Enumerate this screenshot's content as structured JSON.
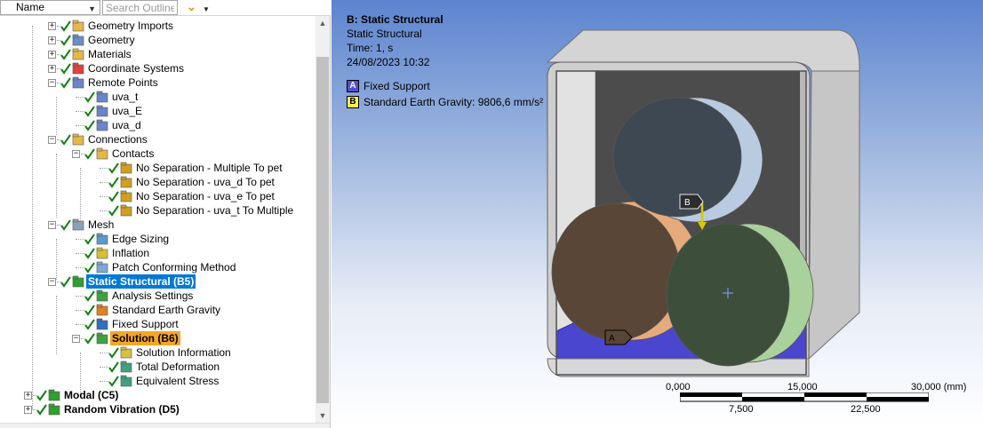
{
  "outline_header": {
    "name_select": "Name",
    "search_placeholder": "Search Outline"
  },
  "tree": [
    {
      "label": "Geometry Imports",
      "icon": "geometry-imports-icon"
    },
    {
      "label": "Geometry",
      "icon": "geometry-icon"
    },
    {
      "label": "Materials",
      "icon": "materials-icon"
    },
    {
      "label": "Coordinate Systems",
      "icon": "coordinate-systems-icon"
    },
    {
      "label": "Remote Points",
      "icon": "remote-points-icon"
    },
    {
      "label": "uva_t",
      "icon": "remote-point-icon"
    },
    {
      "label": "uva_E",
      "icon": "remote-point-icon"
    },
    {
      "label": "uva_d",
      "icon": "remote-point-icon"
    },
    {
      "label": "Connections",
      "icon": "connections-icon"
    },
    {
      "label": "Contacts",
      "icon": "contacts-folder-icon"
    },
    {
      "label": "No Separation - Multiple To pet",
      "icon": "contact-region-icon"
    },
    {
      "label": "No Separation - uva_d To pet",
      "icon": "contact-region-icon"
    },
    {
      "label": "No Separation - uva_e To pet",
      "icon": "contact-region-icon"
    },
    {
      "label": "No Separation - uva_t To Multiple",
      "icon": "contact-region-icon"
    },
    {
      "label": "Mesh",
      "icon": "mesh-icon"
    },
    {
      "label": "Edge Sizing",
      "icon": "edge-sizing-icon"
    },
    {
      "label": "Inflation",
      "icon": "inflation-icon"
    },
    {
      "label": "Patch Conforming Method",
      "icon": "patch-conforming-icon"
    },
    {
      "label": "Static Structural (B5)",
      "icon": "static-structural-icon"
    },
    {
      "label": "Analysis Settings",
      "icon": "analysis-settings-icon"
    },
    {
      "label": "Standard Earth Gravity",
      "icon": "gravity-icon"
    },
    {
      "label": "Fixed Support",
      "icon": "fixed-support-icon"
    },
    {
      "label": "Solution (B6)",
      "icon": "solution-icon"
    },
    {
      "label": "Solution Information",
      "icon": "solution-information-icon"
    },
    {
      "label": "Total Deformation",
      "icon": "total-deformation-icon"
    },
    {
      "label": "Equivalent Stress",
      "icon": "equivalent-stress-icon"
    },
    {
      "label": "Modal (C5)",
      "icon": "modal-icon"
    },
    {
      "label": "Random Vibration (D5)",
      "icon": "random-vibration-icon"
    }
  ],
  "viewport": {
    "title": "B: Static Structural",
    "subtitle": "Static Structural",
    "time": "Time: 1, s",
    "date": "24/08/2023 10:32",
    "legend": [
      {
        "key": "A",
        "label": "Fixed Support",
        "color": "#5050d0"
      },
      {
        "key": "B",
        "label": "Standard Earth Gravity: 9806,6 mm/s²",
        "color": "#f7f050"
      }
    ],
    "tags": {
      "a": "A",
      "b": "B"
    }
  },
  "scale_bar": {
    "top_labels": [
      "0,000",
      "15,000",
      "30,000 (mm)"
    ],
    "bottom_labels": [
      "7,500",
      "22,500"
    ]
  },
  "colors": {
    "selection_blue": "#0078d7",
    "selection_orange": "#f5a623",
    "fixed_support": "#5050d0",
    "gravity_arrow": "#d8c800"
  }
}
